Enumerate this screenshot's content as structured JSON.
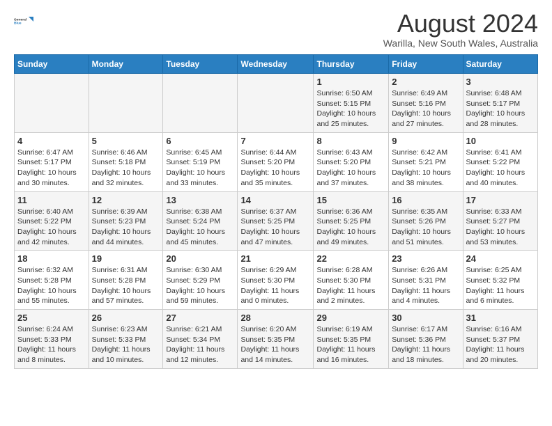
{
  "header": {
    "logo_line1": "General",
    "logo_line2": "Blue",
    "main_title": "August 2024",
    "subtitle": "Warilla, New South Wales, Australia"
  },
  "days_of_week": [
    "Sunday",
    "Monday",
    "Tuesday",
    "Wednesday",
    "Thursday",
    "Friday",
    "Saturday"
  ],
  "weeks": [
    [
      {
        "day": "",
        "detail": ""
      },
      {
        "day": "",
        "detail": ""
      },
      {
        "day": "",
        "detail": ""
      },
      {
        "day": "",
        "detail": ""
      },
      {
        "day": "1",
        "detail": "Sunrise: 6:50 AM\nSunset: 5:15 PM\nDaylight: 10 hours\nand 25 minutes."
      },
      {
        "day": "2",
        "detail": "Sunrise: 6:49 AM\nSunset: 5:16 PM\nDaylight: 10 hours\nand 27 minutes."
      },
      {
        "day": "3",
        "detail": "Sunrise: 6:48 AM\nSunset: 5:17 PM\nDaylight: 10 hours\nand 28 minutes."
      }
    ],
    [
      {
        "day": "4",
        "detail": "Sunrise: 6:47 AM\nSunset: 5:17 PM\nDaylight: 10 hours\nand 30 minutes."
      },
      {
        "day": "5",
        "detail": "Sunrise: 6:46 AM\nSunset: 5:18 PM\nDaylight: 10 hours\nand 32 minutes."
      },
      {
        "day": "6",
        "detail": "Sunrise: 6:45 AM\nSunset: 5:19 PM\nDaylight: 10 hours\nand 33 minutes."
      },
      {
        "day": "7",
        "detail": "Sunrise: 6:44 AM\nSunset: 5:20 PM\nDaylight: 10 hours\nand 35 minutes."
      },
      {
        "day": "8",
        "detail": "Sunrise: 6:43 AM\nSunset: 5:20 PM\nDaylight: 10 hours\nand 37 minutes."
      },
      {
        "day": "9",
        "detail": "Sunrise: 6:42 AM\nSunset: 5:21 PM\nDaylight: 10 hours\nand 38 minutes."
      },
      {
        "day": "10",
        "detail": "Sunrise: 6:41 AM\nSunset: 5:22 PM\nDaylight: 10 hours\nand 40 minutes."
      }
    ],
    [
      {
        "day": "11",
        "detail": "Sunrise: 6:40 AM\nSunset: 5:22 PM\nDaylight: 10 hours\nand 42 minutes."
      },
      {
        "day": "12",
        "detail": "Sunrise: 6:39 AM\nSunset: 5:23 PM\nDaylight: 10 hours\nand 44 minutes."
      },
      {
        "day": "13",
        "detail": "Sunrise: 6:38 AM\nSunset: 5:24 PM\nDaylight: 10 hours\nand 45 minutes."
      },
      {
        "day": "14",
        "detail": "Sunrise: 6:37 AM\nSunset: 5:25 PM\nDaylight: 10 hours\nand 47 minutes."
      },
      {
        "day": "15",
        "detail": "Sunrise: 6:36 AM\nSunset: 5:25 PM\nDaylight: 10 hours\nand 49 minutes."
      },
      {
        "day": "16",
        "detail": "Sunrise: 6:35 AM\nSunset: 5:26 PM\nDaylight: 10 hours\nand 51 minutes."
      },
      {
        "day": "17",
        "detail": "Sunrise: 6:33 AM\nSunset: 5:27 PM\nDaylight: 10 hours\nand 53 minutes."
      }
    ],
    [
      {
        "day": "18",
        "detail": "Sunrise: 6:32 AM\nSunset: 5:28 PM\nDaylight: 10 hours\nand 55 minutes."
      },
      {
        "day": "19",
        "detail": "Sunrise: 6:31 AM\nSunset: 5:28 PM\nDaylight: 10 hours\nand 57 minutes."
      },
      {
        "day": "20",
        "detail": "Sunrise: 6:30 AM\nSunset: 5:29 PM\nDaylight: 10 hours\nand 59 minutes."
      },
      {
        "day": "21",
        "detail": "Sunrise: 6:29 AM\nSunset: 5:30 PM\nDaylight: 11 hours\nand 0 minutes."
      },
      {
        "day": "22",
        "detail": "Sunrise: 6:28 AM\nSunset: 5:30 PM\nDaylight: 11 hours\nand 2 minutes."
      },
      {
        "day": "23",
        "detail": "Sunrise: 6:26 AM\nSunset: 5:31 PM\nDaylight: 11 hours\nand 4 minutes."
      },
      {
        "day": "24",
        "detail": "Sunrise: 6:25 AM\nSunset: 5:32 PM\nDaylight: 11 hours\nand 6 minutes."
      }
    ],
    [
      {
        "day": "25",
        "detail": "Sunrise: 6:24 AM\nSunset: 5:33 PM\nDaylight: 11 hours\nand 8 minutes."
      },
      {
        "day": "26",
        "detail": "Sunrise: 6:23 AM\nSunset: 5:33 PM\nDaylight: 11 hours\nand 10 minutes."
      },
      {
        "day": "27",
        "detail": "Sunrise: 6:21 AM\nSunset: 5:34 PM\nDaylight: 11 hours\nand 12 minutes."
      },
      {
        "day": "28",
        "detail": "Sunrise: 6:20 AM\nSunset: 5:35 PM\nDaylight: 11 hours\nand 14 minutes."
      },
      {
        "day": "29",
        "detail": "Sunrise: 6:19 AM\nSunset: 5:35 PM\nDaylight: 11 hours\nand 16 minutes."
      },
      {
        "day": "30",
        "detail": "Sunrise: 6:17 AM\nSunset: 5:36 PM\nDaylight: 11 hours\nand 18 minutes."
      },
      {
        "day": "31",
        "detail": "Sunrise: 6:16 AM\nSunset: 5:37 PM\nDaylight: 11 hours\nand 20 minutes."
      }
    ]
  ]
}
